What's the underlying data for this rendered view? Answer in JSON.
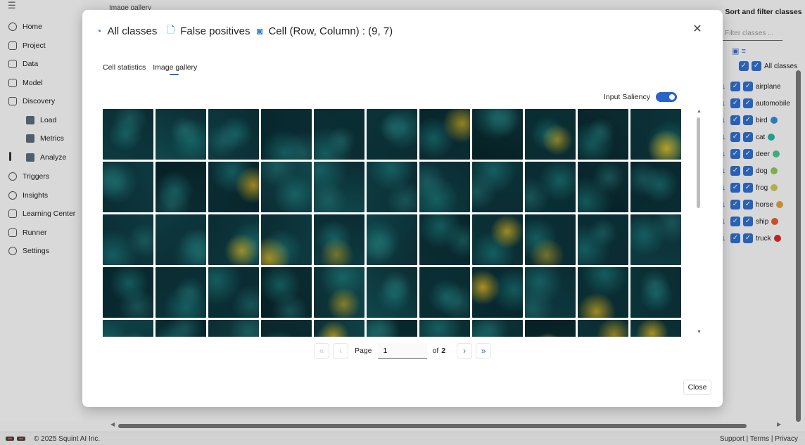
{
  "app": {
    "bg_title": "Image gallery",
    "nav": [
      {
        "label": "Home",
        "icon": "home-icon"
      },
      {
        "label": "Project",
        "icon": "project-icon"
      },
      {
        "label": "Data",
        "icon": "data-icon"
      },
      {
        "label": "Model",
        "icon": "model-icon"
      },
      {
        "label": "Discovery",
        "icon": "discovery-icon"
      },
      {
        "label": "Load",
        "icon": "folder-icon"
      },
      {
        "label": "Metrics",
        "icon": "gears-icon"
      },
      {
        "label": "Analyze",
        "icon": "pie-chart-icon"
      },
      {
        "label": "Triggers",
        "icon": "triggers-icon"
      },
      {
        "label": "Insights",
        "icon": "lightbulb-icon"
      },
      {
        "label": "Learning Center",
        "icon": "books-icon"
      },
      {
        "label": "Runner",
        "icon": "runner-icon"
      },
      {
        "label": "Settings",
        "icon": "settings-icon"
      }
    ],
    "right_panel": {
      "title": "Sort and filter classes",
      "filter_placeholder": "Filter classes ...",
      "all_label": "All classes",
      "classes": [
        {
          "label": "airplane",
          "color": ""
        },
        {
          "label": "automobile",
          "color": ""
        },
        {
          "label": "bird",
          "color": "#2f8fd6"
        },
        {
          "label": "cat",
          "color": "#24b3a8"
        },
        {
          "label": "deer",
          "color": "#4cc38a"
        },
        {
          "label": "dog",
          "color": "#8cc85a"
        },
        {
          "label": "frog",
          "color": "#c6c955"
        },
        {
          "label": "horse",
          "color": "#e0a13c"
        },
        {
          "label": "ship",
          "color": "#e35c2f"
        },
        {
          "label": "truck",
          "color": "#d8282a"
        }
      ]
    },
    "footer": {
      "copyright": "© 2025 Squint AI Inc.",
      "links": "Support | Terms | Privacy"
    }
  },
  "modal": {
    "header": {
      "all_classes": "All classes",
      "false_positives": "False positives",
      "cell": "Cell (Row, Column) : (9, 7)"
    },
    "tabs": [
      "Cell statistics",
      "Image gallery"
    ],
    "active_tab": "Image gallery",
    "saliency_label": "Input Saliency",
    "saliency_on": true,
    "pager": {
      "page_label": "Page",
      "current_page": "1",
      "of_label": "of",
      "total_pages": "2"
    },
    "close_label": "Close"
  }
}
